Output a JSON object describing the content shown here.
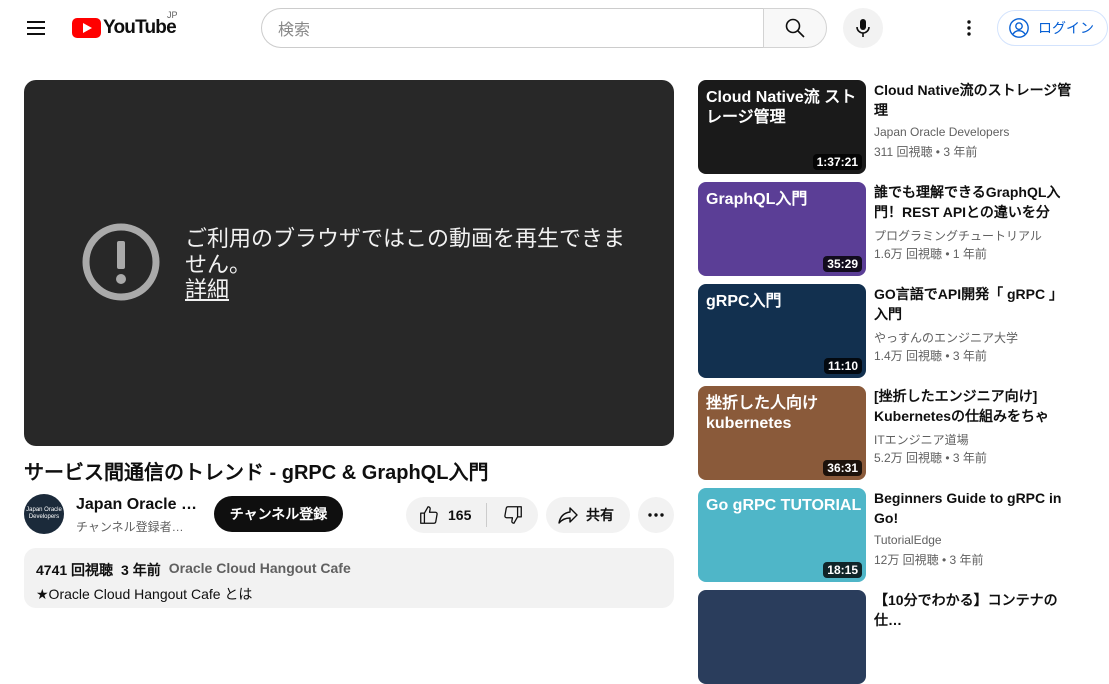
{
  "header": {
    "logo_text": "YouTube",
    "region": "JP",
    "search_placeholder": "検索",
    "login_label": "ログイン"
  },
  "player": {
    "error_message": "ご利用のブラウザではこの動画を再生できません。",
    "details_link": "詳細"
  },
  "video": {
    "title": "サービス間通信のトレンド - gRPC & GraphQL入門",
    "channel_name": "Japan Oracle …",
    "channel_subs": "チャンネル登録者…",
    "avatar_text": "Japan Oracle Developers",
    "subscribe_label": "チャンネル登録",
    "like_count": "165",
    "share_label": "共有",
    "views": "4741 回視聴",
    "age": "3 年前",
    "tag": "Oracle Cloud Hangout Cafe",
    "description": "★Oracle Cloud Hangout Cafe とは"
  },
  "recommendations": [
    {
      "title": "Cloud Native流のストレージ管理",
      "channel": "Japan Oracle Developers",
      "stats": "311 回視聴 • 3 年前",
      "duration": "1:37:21",
      "thumb_text": "Cloud Native流 ストレージ管理",
      "thumb_color": "#1a1a1a"
    },
    {
      "title": "誰でも理解できるGraphQL入門！REST APIとの違いを分か…",
      "channel": "プログラミングチュートリアル",
      "stats": "1.6万 回視聴 • 1 年前",
      "duration": "35:29",
      "thumb_text": "GraphQL入門",
      "thumb_color": "#5b3e96"
    },
    {
      "title": "GO言語でAPI開発「 gRPC 」入門",
      "channel": "やっすんのエンジニア大学",
      "stats": "1.4万 回視聴 • 3 年前",
      "duration": "11:10",
      "thumb_text": "gRPC入門",
      "thumb_color": "#12304f"
    },
    {
      "title": "[挫折したエンジニア向け] Kubernetesの仕組みをちゃん…",
      "channel": "ITエンジニア道場",
      "stats": "5.2万 回視聴 • 3 年前",
      "duration": "36:31",
      "thumb_text": "挫折した人向け kubernetes",
      "thumb_color": "#8a5a3a"
    },
    {
      "title": "Beginners Guide to gRPC in Go!",
      "channel": "TutorialEdge",
      "stats": "12万 回視聴 • 3 年前",
      "duration": "18:15",
      "thumb_text": "Go gRPC TUTORIAL",
      "thumb_color": "#4fb6c8"
    },
    {
      "title": "【10分でわかる】コンテナの仕…",
      "channel": "",
      "stats": "",
      "duration": "",
      "thumb_text": "",
      "thumb_color": "#2a3d5c"
    }
  ]
}
